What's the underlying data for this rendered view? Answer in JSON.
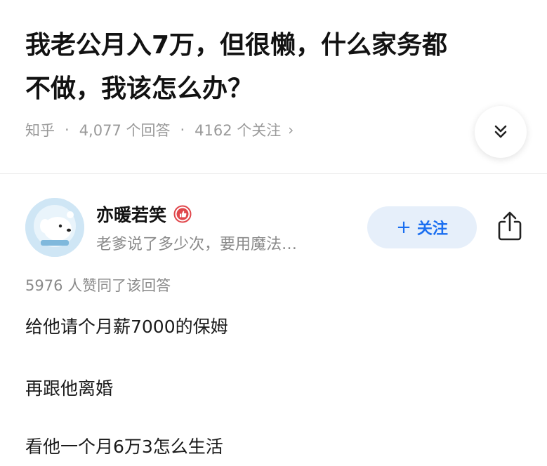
{
  "question": {
    "title_line1": "我老公月入7万，但很懒，什么家务都",
    "title_line2": "不做，我该怎么办？",
    "source": "知乎",
    "answers_count": "4,077 个回答",
    "followers_count": "4162 个关注",
    "expand_icon": "chevron-double-down-icon"
  },
  "answer": {
    "author_name": "亦暖若笑",
    "author_badge_icon": "thumbs-up-badge-icon",
    "author_bio": "老爹说了多少次，要用魔法…",
    "follow_label": "关注",
    "follow_plus": "+",
    "share_icon": "share-icon",
    "vote_text": "5976 人赞同了该回答",
    "lines": [
      "给他请个月薪7000的保姆",
      "再跟他离婚",
      "看他一个月6万3怎么生活"
    ]
  },
  "colors": {
    "accent": "#1a6ef0",
    "follow_bg": "#e6effa",
    "meta_gray": "#9a9a9a",
    "badge_red": "#e0464b"
  }
}
